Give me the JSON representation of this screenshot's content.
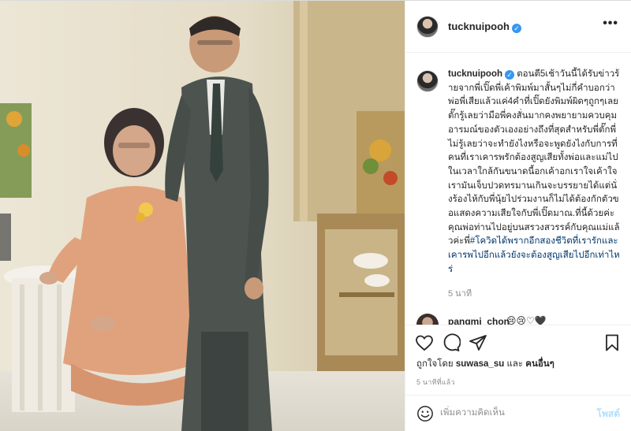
{
  "post": {
    "username": "tucknuipooh",
    "verified": true,
    "more_label": "•••",
    "caption": {
      "username": "tucknuipooh",
      "text": "ตอนตี5เช้าวันนี้ได้รับข่าวร้ายจากพี่เปิ๊ดพี่เค้าพิมพ์มาสั้นๆไม่กี่คำบอกว่าพ่อพี่เสียแล้วแค่4คำที่เปิ๊ดยังพิมพ์ผิดๆถูกๆเลยตั๊กรู้เลยว่ามือพี่คงสั่นมากคงพยายามควบคุมอารมณ์ของตัวเองอย่างถึงที่สุดสำหรับพี่ตั๊กพี่ไม่รู้เลยว่าจะทำยังไงหรือจะพูดยังไงกับการที่คนที่เราเคารพรักต้องสูญเสียทั้งพ่อและแม่ไปในเวลาใกล้กันขนาดนี้อกเค้าอกเราใจเค้าใจเรามันเจ็บปวดทรมานเกินจะบรรยายได้แต่นั่งร้องไห้กับพี่นุ้ยไปร่วมงานก็ไม่ได้ต้องกักตัวขอแสดงความเสียใจกับพี่เปิ๊ดมาณ.ที่นี้ด้วยค่ะคุณพ่อท่านไปอยู่บนสรวงสวรรค์กับคุณแม่แล้วค่ะพี่",
      "hashtag": "#โควิดได้พรากอีกสองชีวิตที่เรารักและเคารพไปอีกแล้วยังจะต้องสูญเสียไปอีกเท่าไหร่",
      "time": "5 นาที"
    },
    "comment": {
      "username": "pangmi_chon",
      "text": "😢😢♡🖤"
    },
    "likes": {
      "prefix": "ถูกใจโดย",
      "user": "suwasa_su",
      "middle": "และ",
      "others": "คนอื่นๆ"
    },
    "time_ago": "5 นาทีที่แล้ว",
    "add_comment": {
      "placeholder": "เพิ่มความคิดเห็น",
      "post_label": "โพสต์"
    },
    "icons": {
      "like": "heart-icon",
      "comment": "comment-icon",
      "share": "share-icon",
      "save": "bookmark-icon",
      "emoji": "emoji-icon"
    },
    "colors": {
      "link": "#00376b",
      "verified": "#3897f0",
      "post_disabled": "#b2dffc",
      "muted": "#8e8e8e"
    }
  }
}
